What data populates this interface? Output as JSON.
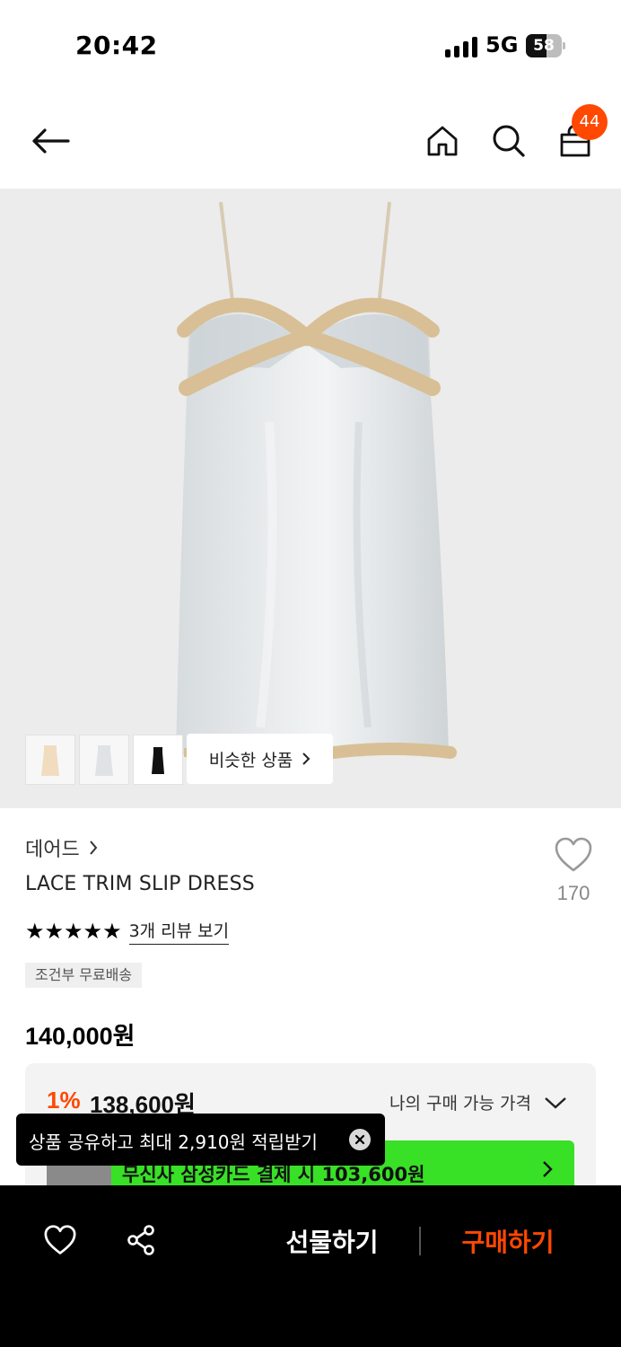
{
  "status_bar": {
    "time": "20:42",
    "network": "5G",
    "battery": "58",
    "battery_level": 0.58
  },
  "nav": {
    "back_icon": "arrow-left-icon",
    "home_icon": "home-icon",
    "search_icon": "search-icon",
    "cart_icon": "shopping-bag-icon",
    "cart_count": "44"
  },
  "gallery": {
    "thumbnail_count": 3,
    "similar_label": "비슷한 상품"
  },
  "product": {
    "brand": "데어드",
    "name": "LACE TRIM SLIP DRESS",
    "like_count": "170",
    "rating": 5,
    "stars": "★★★★★",
    "review_link": "3개 리뷰 보기",
    "shipping_tag": "조건부 무료배송",
    "price": "140,000원"
  },
  "price_box": {
    "discount_percent": "1%",
    "discount_price": "138,600원",
    "my_price_label": "나의 구매 가능 가격",
    "card_promo_text": "무신사 삼성카드 결제 시 103,600원",
    "promo_color": "#38e026"
  },
  "toast": {
    "text": "상품 공유하고 최대 2,910원 적립받기"
  },
  "bottom_bar": {
    "like_icon": "heart-icon",
    "share_icon": "share-icon",
    "gift_label": "선물하기",
    "buy_label": "구매하기"
  },
  "colors": {
    "accent": "#ff4800",
    "hero_bg": "#ececec",
    "bottom_bar_bg": "#000000"
  }
}
